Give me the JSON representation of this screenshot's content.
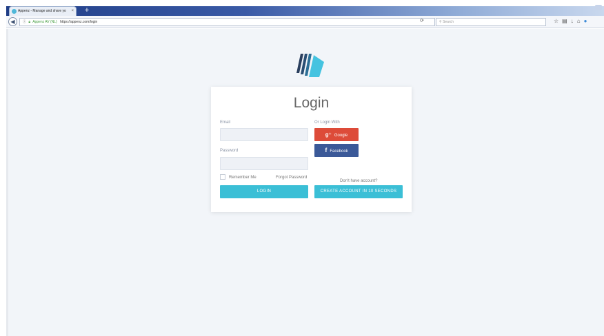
{
  "browser": {
    "tab_title": "Appenz - Manage and share yo",
    "tab_close": "×",
    "new_tab": "+",
    "url_org": "Appenz AV (NL)",
    "url": "https://appenz.com/login",
    "search_placeholder": "Search",
    "reload_icon": "⟳"
  },
  "login": {
    "title": "Login",
    "email_label": "Email",
    "email_value": "",
    "password_label": "Password",
    "password_value": "",
    "remember_label": "Remember Me",
    "forgot_label": "Forgot Password",
    "login_button": "LOGIN",
    "social_label": "Or Login With",
    "google_button": "Google",
    "facebook_button": "Facebook",
    "no_account_text": "Don't have account?",
    "create_button": "CREATE ACCOUNT IN 10 SECONDS"
  },
  "colors": {
    "accent": "#3bbfd6",
    "google": "#dd4b39",
    "facebook": "#3b5998",
    "page_bg": "#f2f5f9"
  }
}
